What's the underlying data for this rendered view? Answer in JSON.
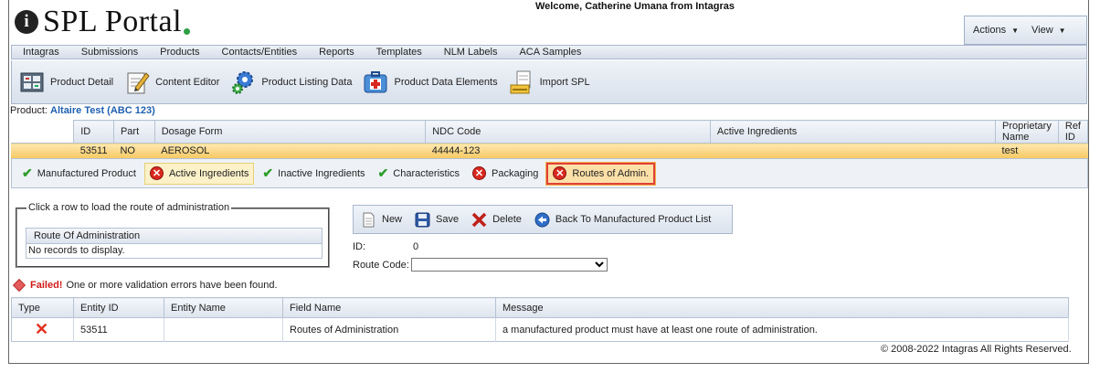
{
  "header": {
    "logo_text": "SPL Portal",
    "logo_letter": "i",
    "welcome": "Welcome, Catherine Umana from Intagras",
    "actions_label": "Actions",
    "view_label": "View"
  },
  "menu": [
    "Intagras",
    "Submissions",
    "Products",
    "Contacts/Entities",
    "Reports",
    "Templates",
    "NLM Labels",
    "ACA Samples"
  ],
  "toolbar": {
    "product_detail": "Product Detail",
    "content_editor": "Content Editor",
    "product_listing": "Product Listing Data",
    "product_data_elements": "Product Data Elements",
    "import_spl": "Import SPL"
  },
  "product": {
    "label": "Product:",
    "value": "Altaire Test (ABC 123)"
  },
  "product_table": {
    "headers": [
      "ID",
      "Part",
      "Dosage Form",
      "NDC Code",
      "Active Ingredients",
      "Proprietary Name",
      "Ref ID"
    ],
    "row": {
      "id": "53511",
      "part": "NO",
      "dosage_form": "AEROSOL",
      "ndc": "44444-123",
      "active": "",
      "proprietary": "test",
      "ref_id": ""
    }
  },
  "tabs": [
    {
      "label": "Manufactured Product",
      "status": "ok"
    },
    {
      "label": "Active Ingredients",
      "status": "error"
    },
    {
      "label": "Inactive Ingredients",
      "status": "ok"
    },
    {
      "label": "Characteristics",
      "status": "ok"
    },
    {
      "label": "Packaging",
      "status": "error"
    },
    {
      "label": "Routes of Admin.",
      "status": "error"
    }
  ],
  "route_panel": {
    "legend": "Click a row to load the route of administration",
    "column": "Route Of Administration",
    "empty": "No records to display."
  },
  "actions": {
    "new": "New",
    "save": "Save",
    "delete": "Delete",
    "back": "Back To Manufactured Product List"
  },
  "form": {
    "id_label": "ID:",
    "id_value": "0",
    "route_label": "Route Code:",
    "route_value": ""
  },
  "validation": {
    "failed": "Failed!",
    "message": "One or more validation errors have been found.",
    "headers": [
      "Type",
      "Entity ID",
      "Entity Name",
      "Field Name",
      "Message"
    ],
    "rows": [
      {
        "entity_id": "53511",
        "entity_name": "",
        "field": "Routes of Administration",
        "message": "a manufactured product must have at least one route of administration."
      }
    ]
  },
  "footer": {
    "copyright": "© 2008-2022 Intagras All Rights Reserved."
  },
  "colors": {
    "link": "#1f5fb0",
    "error": "#d8281f",
    "ok": "#2e9d2a",
    "selected_row": "#f7c860"
  }
}
